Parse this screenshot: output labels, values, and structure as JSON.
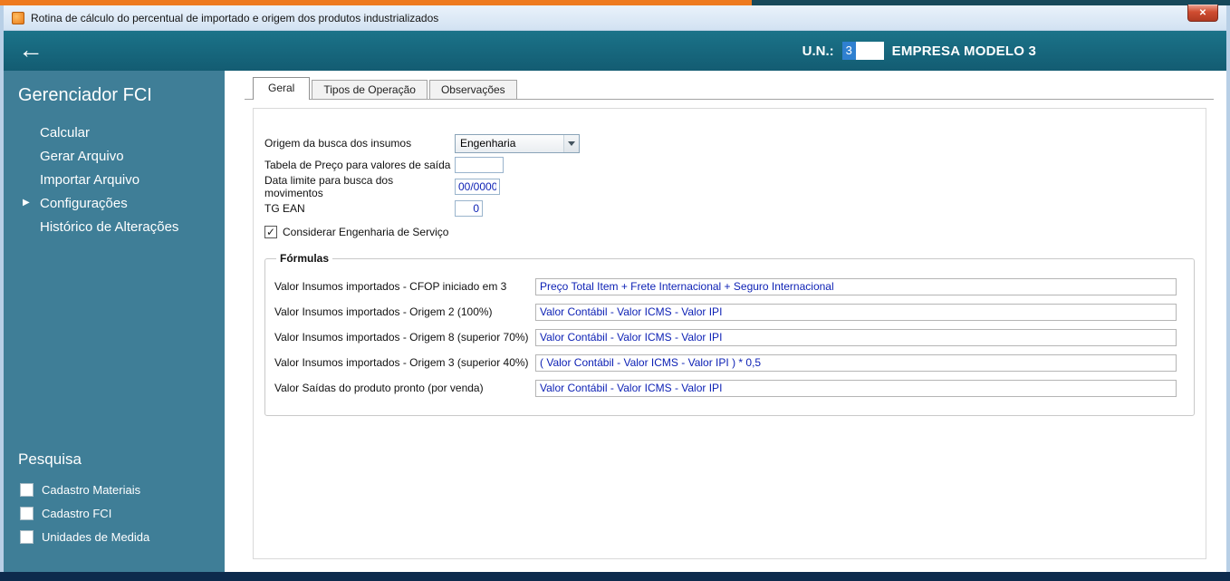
{
  "window": {
    "title": "Rotina de cálculo do percentual de importado e origem dos produtos industrializados",
    "close_glyph": "✕"
  },
  "header": {
    "back_glyph": "←",
    "un_label": "U.N.:",
    "un_value": "3",
    "company": "EMPRESA MODELO 3"
  },
  "sidebar": {
    "title": "Gerenciador FCI",
    "items": [
      {
        "label": "Calcular"
      },
      {
        "label": "Gerar Arquivo"
      },
      {
        "label": "Importar Arquivo"
      },
      {
        "label": "Configurações",
        "arrow_glyph": "▶"
      },
      {
        "label": "Histórico de Alterações"
      }
    ],
    "search_title": "Pesquisa",
    "search_items": [
      {
        "label": "Cadastro Materiais"
      },
      {
        "label": "Cadastro FCI"
      },
      {
        "label": "Unidades de Medida"
      }
    ]
  },
  "tabs": [
    {
      "label": "Geral"
    },
    {
      "label": "Tipos de Operação"
    },
    {
      "label": "Observações"
    }
  ],
  "form": {
    "fields": [
      {
        "label": "Origem da busca dos insumos",
        "value": "Engenharia"
      },
      {
        "label": "Tabela de Preço para valores de saída",
        "value": ""
      },
      {
        "label": "Data limite para busca dos movimentos",
        "value": "00/0000"
      },
      {
        "label": "TG EAN",
        "value": "0"
      }
    ],
    "checkbox": {
      "label": "Considerar Engenharia de Serviço",
      "checked": true,
      "check_glyph": "✓"
    }
  },
  "formulas": {
    "title": "Fórmulas",
    "rows": [
      {
        "label": "Valor Insumos importados - CFOP iniciado em 3",
        "value": "Preço Total Item + Frete Internacional + Seguro Internacional"
      },
      {
        "label": "Valor Insumos importados - Origem 2 (100%)",
        "value": "Valor Contábil - Valor ICMS - Valor IPI"
      },
      {
        "label": "Valor Insumos importados - Origem 8 (superior 70%)",
        "value": "Valor Contábil - Valor ICMS - Valor IPI"
      },
      {
        "label": "Valor Insumos importados - Origem 3 (superior 40%)",
        "value": "( Valor Contábil - Valor ICMS - Valor IPI ) * 0,5"
      },
      {
        "label": "Valor Saídas do produto pronto (por venda)",
        "value": "Valor Contábil - Valor ICMS - Valor IPI"
      }
    ]
  },
  "colors": {
    "accent_orange": "#ee7a1f",
    "header_teal": "#176b81",
    "sidebar_blue": "#3f7e97",
    "formula_text_blue": "#0b1fb4",
    "selection_blue": "#2f80d0",
    "close_red": "#c24530",
    "bottom_bar_navy": "#0d2b4d"
  }
}
